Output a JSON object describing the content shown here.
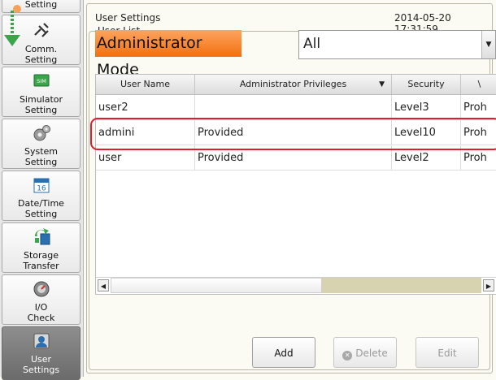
{
  "sidebar": {
    "items": [
      {
        "label": "Setting",
        "icon": "settings-icon"
      },
      {
        "label": "Comm.\nSetting",
        "icon": "comm-icon"
      },
      {
        "label": "Simulator\nSetting",
        "icon": "sim-icon",
        "icon_text": "SIM"
      },
      {
        "label": "System\nSetting",
        "icon": "gear-icon"
      },
      {
        "label": "Date/Time\nSetting",
        "icon": "calendar-icon",
        "icon_text": "16"
      },
      {
        "label": "Storage\nTransfer",
        "icon": "storage-transfer-icon"
      },
      {
        "label": "I/O\nCheck",
        "icon": "io-check-icon"
      },
      {
        "label": "User\nSettings",
        "icon": "user-icon",
        "active": true
      }
    ]
  },
  "header": {
    "title": "User Settings",
    "datetime": "2014-05-20 17:31:59"
  },
  "user_list": {
    "legend": "User List",
    "mode_label": "Administrator Mode",
    "filter": {
      "selected": "All"
    },
    "columns": [
      "User Name",
      "Administrator Privileges",
      "Security",
      "\\"
    ],
    "rows": [
      {
        "name": "user2",
        "privileges": "",
        "security": "Level3",
        "extra": "Proh"
      },
      {
        "name": "admini",
        "privileges": "Provided",
        "security": "Level10",
        "extra": "Proh"
      },
      {
        "name": "user",
        "privileges": "Provided",
        "security": "Level2",
        "extra": "Proh"
      }
    ]
  },
  "actions": {
    "add": "Add",
    "delete": "Delete",
    "edit": "Edit"
  },
  "colors": {
    "mode_accent": "#f4741a",
    "highlight": "#e11b2b"
  }
}
